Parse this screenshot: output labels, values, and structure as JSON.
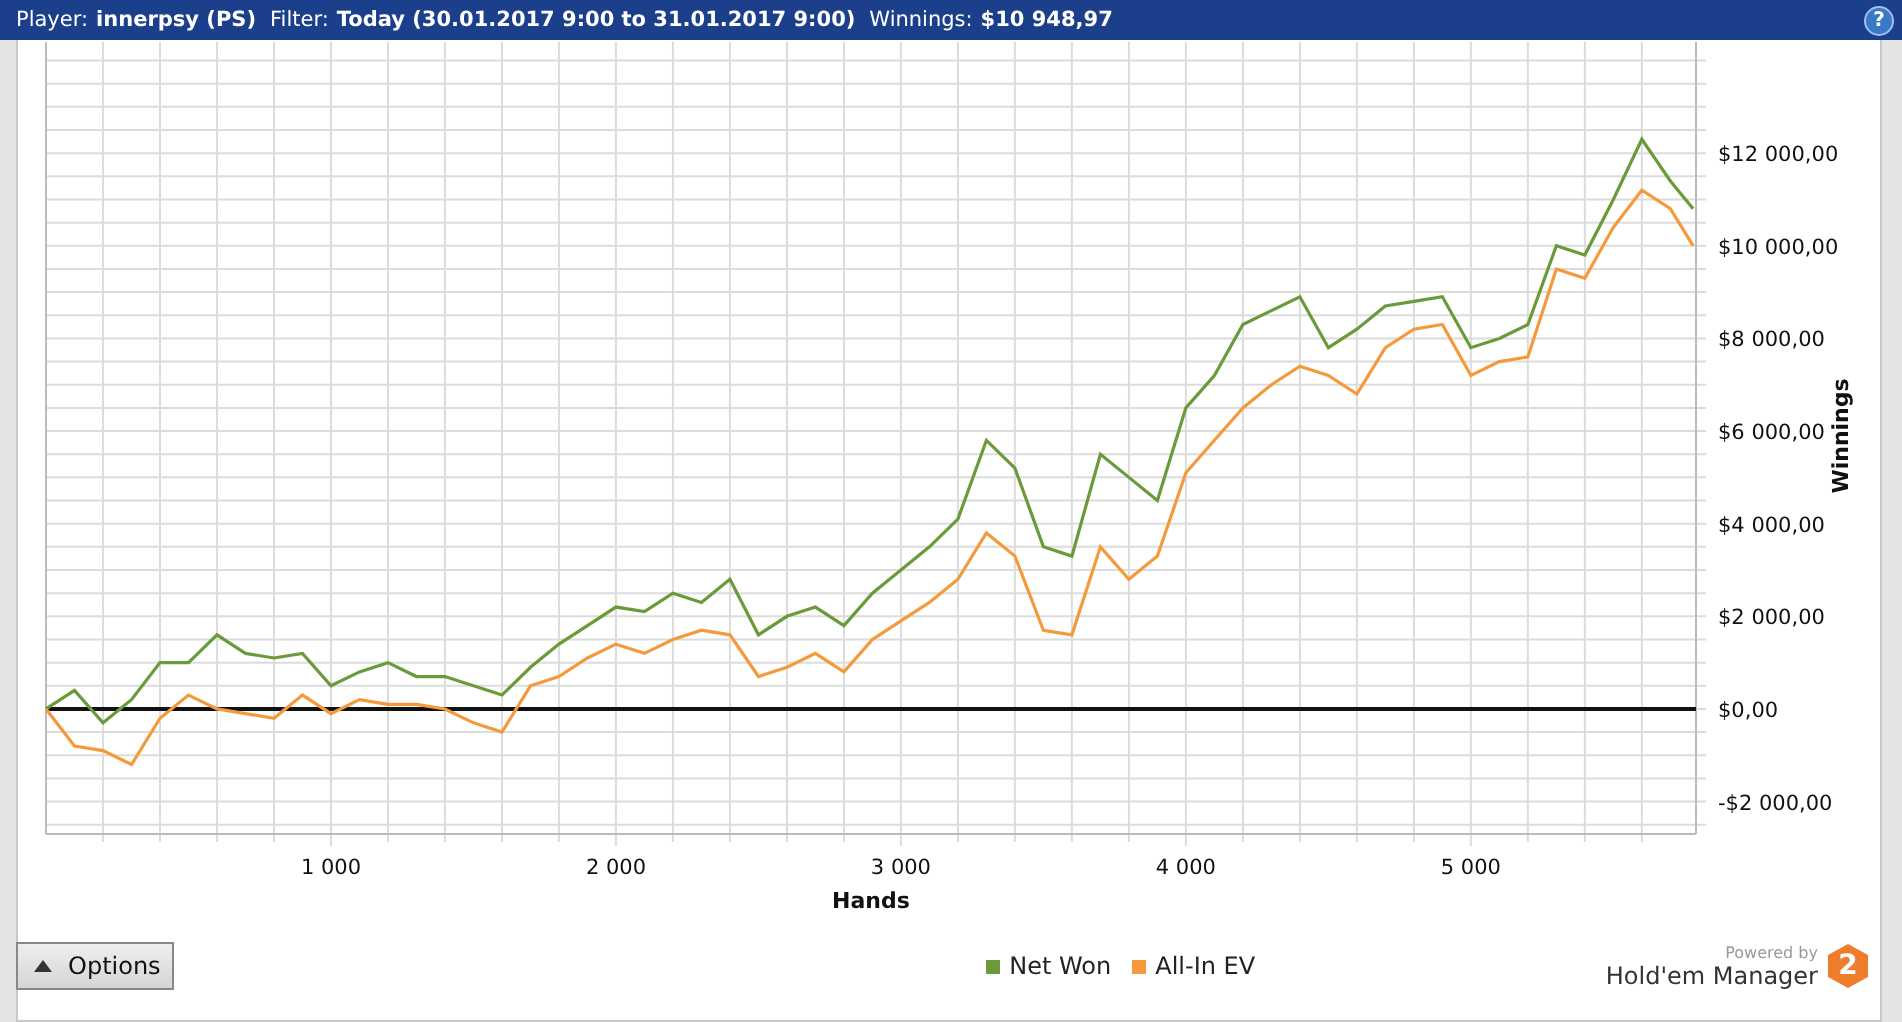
{
  "title_bar": {
    "fields": [
      {
        "label": "Player:",
        "value": "innerpsy (PS)"
      },
      {
        "label": "Filter:",
        "value": "Today (30.01.2017 9:00 to 31.01.2017 9:00)"
      },
      {
        "label": "Winnings:",
        "value": "$10 948,97"
      }
    ],
    "help": "?"
  },
  "chart": {
    "chart_data": {
      "type": "line",
      "xlabel": "Hands",
      "ylabel": "Winnings",
      "x": [
        0,
        100,
        200,
        300,
        400,
        500,
        600,
        700,
        800,
        900,
        1000,
        1100,
        1200,
        1300,
        1400,
        1500,
        1600,
        1700,
        1800,
        1900,
        2000,
        2100,
        2200,
        2300,
        2400,
        2500,
        2600,
        2700,
        2800,
        2900,
        3000,
        3100,
        3200,
        3300,
        3400,
        3500,
        3600,
        3700,
        3800,
        3900,
        4000,
        4100,
        4200,
        4300,
        4400,
        4500,
        4600,
        4700,
        4800,
        4900,
        5000,
        5100,
        5200,
        5300,
        5400,
        5500,
        5600,
        5700,
        5780
      ],
      "series": [
        {
          "name": "Net Won",
          "color": "#6a9a3a",
          "values": [
            0,
            400,
            -300,
            200,
            1000,
            1000,
            1600,
            1200,
            1100,
            1200,
            500,
            800,
            1000,
            700,
            700,
            500,
            300,
            900,
            1400,
            1800,
            2200,
            2100,
            2500,
            2300,
            2800,
            1600,
            2000,
            2200,
            1800,
            2500,
            3000,
            3500,
            4100,
            5800,
            5200,
            3500,
            3300,
            5500,
            5000,
            4500,
            6500,
            7200,
            8300,
            8600,
            8900,
            7800,
            8200,
            8700,
            8800,
            8900,
            7800,
            8000,
            8300,
            10000,
            9800,
            11000,
            12300,
            11400,
            10800
          ]
        },
        {
          "name": "All-In EV",
          "color": "#f59a3c",
          "values": [
            0,
            -800,
            -900,
            -1200,
            -200,
            300,
            0,
            -100,
            -200,
            300,
            -100,
            200,
            100,
            100,
            0,
            -300,
            -500,
            500,
            700,
            1100,
            1400,
            1200,
            1500,
            1700,
            1600,
            700,
            900,
            1200,
            800,
            1500,
            1900,
            2300,
            2800,
            3800,
            3300,
            1700,
            1600,
            3500,
            2800,
            3300,
            5100,
            5800,
            6500,
            7000,
            7400,
            7200,
            6800,
            7800,
            8200,
            8300,
            7200,
            7500,
            7600,
            9500,
            9300,
            10400,
            11200,
            10800,
            10000
          ]
        }
      ],
      "grid": true,
      "xlim": [
        0,
        5790
      ],
      "ylim": [
        -2700,
        14400
      ],
      "xticks": [
        {
          "value": 1000,
          "label": "1 000"
        },
        {
          "value": 2000,
          "label": "2 000"
        },
        {
          "value": 3000,
          "label": "3 000"
        },
        {
          "value": 4000,
          "label": "4 000"
        },
        {
          "value": 5000,
          "label": "5 000"
        }
      ],
      "yticks": [
        {
          "value": -2000,
          "label": "-$2 000,00"
        },
        {
          "value": 0,
          "label": "$0,00"
        },
        {
          "value": 2000,
          "label": "$2 000,00"
        },
        {
          "value": 4000,
          "label": "$4 000,00"
        },
        {
          "value": 6000,
          "label": "$6 000,00"
        },
        {
          "value": 8000,
          "label": "$8 000,00"
        },
        {
          "value": 10000,
          "label": "$10 000,00"
        },
        {
          "value": 12000,
          "label": "$12 000,00"
        }
      ]
    }
  },
  "options_button": "Options",
  "branding": {
    "powered_by": "Powered by",
    "name": "Hold'em Manager",
    "badge": "2"
  }
}
